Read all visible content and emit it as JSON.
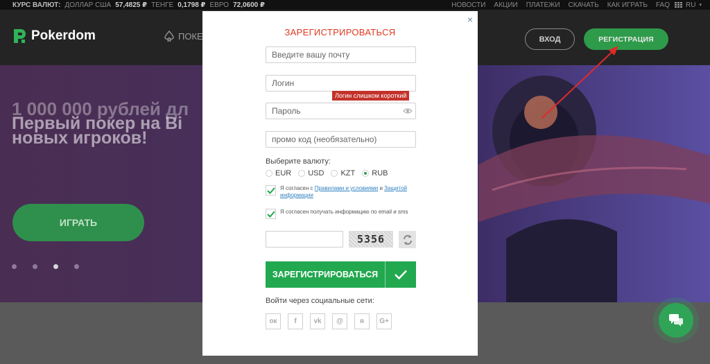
{
  "topbar": {
    "rates_label": "КУРС ВАЛЮТ:",
    "rates": [
      {
        "name": "ДОЛЛАР США",
        "value": "57,4825 ₽"
      },
      {
        "name": "ТЕНГЕ",
        "value": "0,1798 ₽"
      },
      {
        "name": "ЕВРО",
        "value": "72,0600 ₽"
      }
    ],
    "nav": [
      "НОВОСТИ",
      "АКЦИИ",
      "ПЛАТЕЖИ",
      "СКАЧАТЬ",
      "КАК ИГРАТЬ",
      "FAQ"
    ],
    "lang": "RU"
  },
  "header": {
    "logo_text": "Pokerdom",
    "poker_link": "ПОКЕ",
    "login_label": "ВХОД",
    "register_label": "РЕГИСТРАЦИЯ"
  },
  "hero": {
    "ghost_text": "1 000 000 рублей дл",
    "title_line1": "Первый покер на Bi",
    "title_line2": "новых игроков!",
    "play_label": "ИГРАТЬ",
    "slides_total": 4,
    "slide_active": 3
  },
  "modal": {
    "title": "ЗАРЕГИСТРИРОВАТЬСЯ",
    "email_placeholder": "Введите вашу почту",
    "login_value": "Логин",
    "login_error": "Логин слишком короткий",
    "password_placeholder": "Пароль",
    "promo_placeholder": "промо код (необязательно)",
    "currency_label": "Выберите валюту:",
    "currencies": [
      {
        "code": "EUR",
        "checked": false
      },
      {
        "code": "USD",
        "checked": false
      },
      {
        "code": "KZT",
        "checked": false
      },
      {
        "code": "RUB",
        "checked": true
      }
    ],
    "agree_prefix": "Я согласен с ",
    "agree_rules_link": "Правилами и условиями",
    "agree_and": " и ",
    "agree_privacy_link": "Защитой информации",
    "agree_news": "Я согласен получать информацию по email и sms",
    "captcha_text": "5356",
    "submit_label": "ЗАРЕГИСТРИРОВАТЬСЯ",
    "social_label": "Войти через социальные сети:",
    "socials": [
      "ok-icon",
      "facebook-icon",
      "vk-icon",
      "mail-icon",
      "yandex-icon",
      "google-plus-icon"
    ]
  },
  "colors": {
    "accent_green": "#22a84f",
    "title_red": "#e0371f",
    "error_red": "#c3322a",
    "annotation_arrow": "#e02a2a"
  }
}
